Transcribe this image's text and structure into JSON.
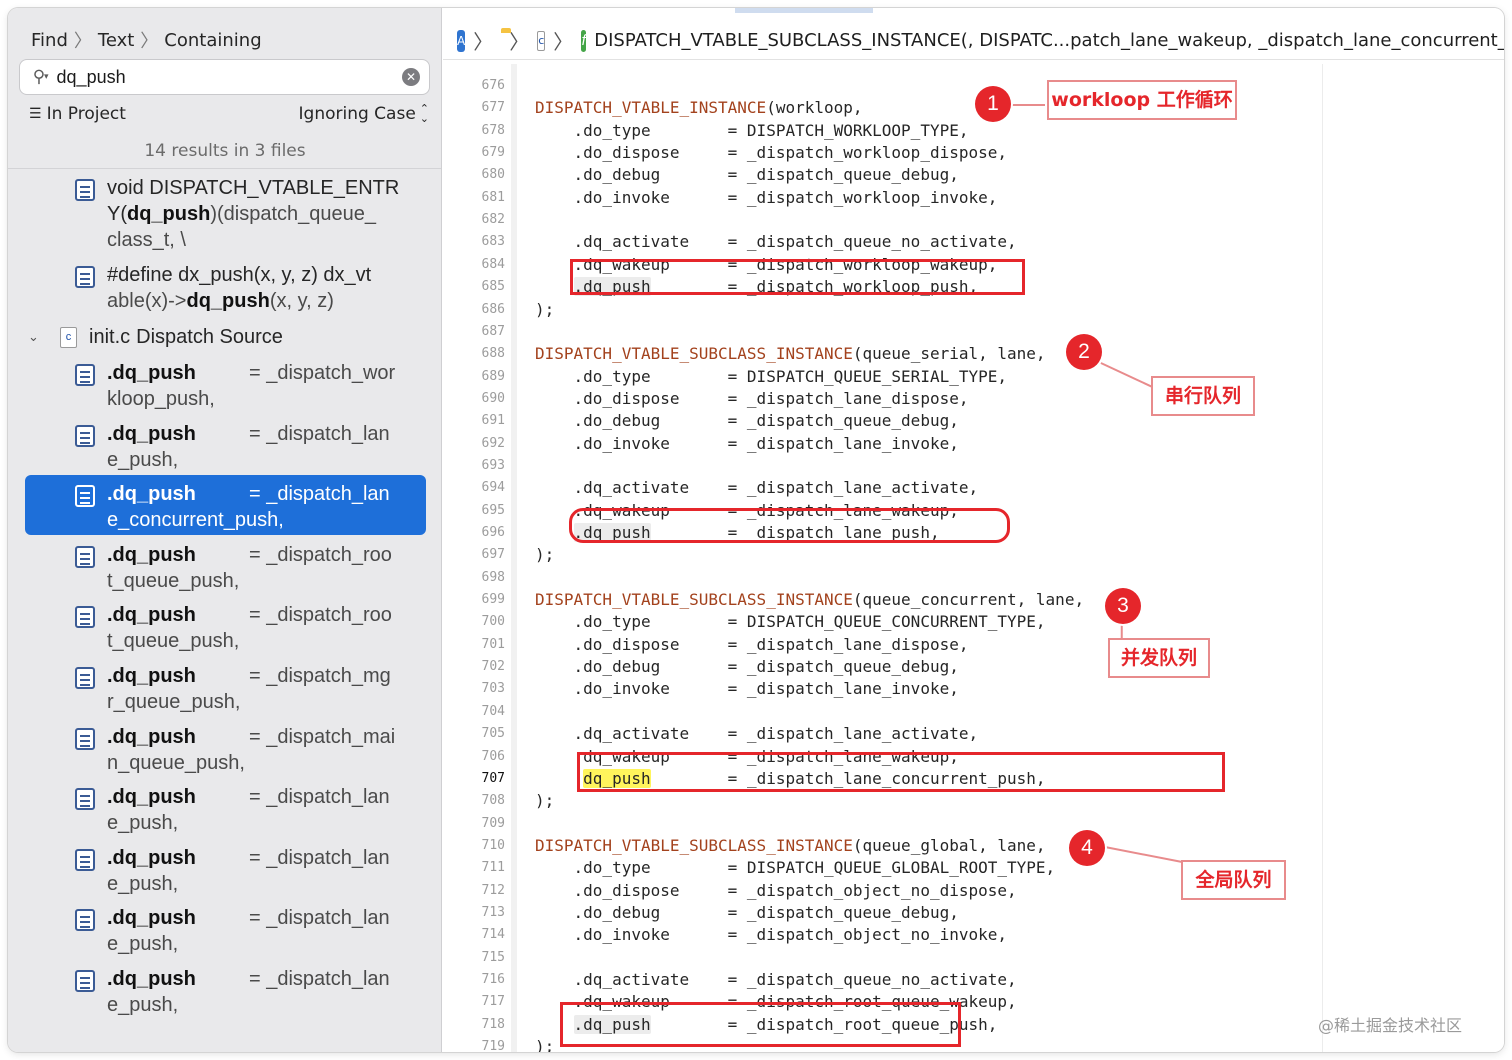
{
  "sidebar": {
    "breadcrumb": [
      "Find",
      "Text",
      "Containing"
    ],
    "search": {
      "value": "dq_push",
      "placeholder": ""
    },
    "scope": "In Project",
    "case_mode": "Ignoring Case",
    "summary": "14 results in 3 files",
    "pre_results": [
      {
        "line1_pre": "void DISPATCH_VTABLE_ENTR",
        "line2_pre": "Y(",
        "match": "dq_push",
        "line2_post": ")(dispatch_queue_",
        "line3": "class_t, \\"
      },
      {
        "line1": "#define dx_push(x, y, z) dx_vt",
        "line2_pre": "able(x)->",
        "match": "dq_push",
        "line2_post": "(x, y, z)"
      }
    ],
    "file_group": {
      "name": "init.c",
      "kind": "Dispatch Source"
    },
    "results": [
      {
        "match": ".dq_push",
        "rest1": "= _dispatch_wor",
        "rest2": "kloop_push,"
      },
      {
        "match": ".dq_push",
        "rest1": "= _dispatch_lan",
        "rest2": "e_push,"
      },
      {
        "match": ".dq_push",
        "rest1": "= _dispatch_lan",
        "rest2": "e_concurrent_push,",
        "selected": true
      },
      {
        "match": ".dq_push",
        "rest1": "= _dispatch_roo",
        "rest2": "t_queue_push,"
      },
      {
        "match": ".dq_push",
        "rest1": "= _dispatch_roo",
        "rest2": "t_queue_push,"
      },
      {
        "match": ".dq_push",
        "rest1": "= _dispatch_mg",
        "rest2": "r_queue_push,"
      },
      {
        "match": ".dq_push",
        "rest1": "= _dispatch_mai",
        "rest2": "n_queue_push,"
      },
      {
        "match": ".dq_push",
        "rest1": "= _dispatch_lan",
        "rest2": "e_push,"
      },
      {
        "match": ".dq_push",
        "rest1": "= _dispatch_lan",
        "rest2": "e_push,"
      },
      {
        "match": ".dq_push",
        "rest1": "= _dispatch_lan",
        "rest2": "e_push,"
      },
      {
        "match": ".dq_push",
        "rest1": "= _dispatch_lan",
        "rest2": "e_push,"
      }
    ]
  },
  "editor": {
    "jumpbar": {
      "file_letter": "c",
      "func_letter": "f",
      "symbol": "DISPATCH_VTABLE_SUBCLASS_INSTANCE(, DISPATC...patch_lane_wakeup, _dispatch_lane_concurrent_p"
    },
    "current_line": 707,
    "lines": [
      {
        "n": 676,
        "kw": "",
        "text": ""
      },
      {
        "n": 677,
        "kw": "DISPATCH_VTABLE_INSTANCE",
        "text": "(workloop,"
      },
      {
        "n": 678,
        "kw": "",
        "text": "    .do_type        = DISPATCH_WORKLOOP_TYPE,"
      },
      {
        "n": 679,
        "kw": "",
        "text": "    .do_dispose     = _dispatch_workloop_dispose,"
      },
      {
        "n": 680,
        "kw": "",
        "text": "    .do_debug       = _dispatch_queue_debug,"
      },
      {
        "n": 681,
        "kw": "",
        "text": "    .do_invoke      = _dispatch_workloop_invoke,"
      },
      {
        "n": 682,
        "kw": "",
        "text": ""
      },
      {
        "n": 683,
        "kw": "",
        "text": "    .dq_activate    = _dispatch_queue_no_activate,"
      },
      {
        "n": 684,
        "kw": "",
        "text": "    .dq_wakeup      = _dispatch_workloop_wakeup,"
      },
      {
        "n": 685,
        "kw": "",
        "hl": ".dq_push",
        "pre": "    ",
        "text": "        = _dispatch_workloop_push,"
      },
      {
        "n": 686,
        "kw": "",
        "text": ");"
      },
      {
        "n": 687,
        "kw": "",
        "text": ""
      },
      {
        "n": 688,
        "kw": "DISPATCH_VTABLE_SUBCLASS_INSTANCE",
        "text": "(queue_serial, lane,"
      },
      {
        "n": 689,
        "kw": "",
        "text": "    .do_type        = DISPATCH_QUEUE_SERIAL_TYPE,"
      },
      {
        "n": 690,
        "kw": "",
        "text": "    .do_dispose     = _dispatch_lane_dispose,"
      },
      {
        "n": 691,
        "kw": "",
        "text": "    .do_debug       = _dispatch_queue_debug,"
      },
      {
        "n": 692,
        "kw": "",
        "text": "    .do_invoke      = _dispatch_lane_invoke,"
      },
      {
        "n": 693,
        "kw": "",
        "text": ""
      },
      {
        "n": 694,
        "kw": "",
        "text": "    .dq_activate    = _dispatch_lane_activate,"
      },
      {
        "n": 695,
        "kw": "",
        "text": "    .dq_wakeup      = _dispatch_lane_wakeup,"
      },
      {
        "n": 696,
        "kw": "",
        "hl": ".dq_push",
        "pre": "    ",
        "text": "        = _dispatch_lane_push,"
      },
      {
        "n": 697,
        "kw": "",
        "text": ");"
      },
      {
        "n": 698,
        "kw": "",
        "text": ""
      },
      {
        "n": 699,
        "kw": "DISPATCH_VTABLE_SUBCLASS_INSTANCE",
        "text": "(queue_concurrent, lane,"
      },
      {
        "n": 700,
        "kw": "",
        "text": "    .do_type        = DISPATCH_QUEUE_CONCURRENT_TYPE,"
      },
      {
        "n": 701,
        "kw": "",
        "text": "    .do_dispose     = _dispatch_lane_dispose,"
      },
      {
        "n": 702,
        "kw": "",
        "text": "    .do_debug       = _dispatch_queue_debug,"
      },
      {
        "n": 703,
        "kw": "",
        "text": "    .do_invoke      = _dispatch_lane_invoke,"
      },
      {
        "n": 704,
        "kw": "",
        "text": ""
      },
      {
        "n": 705,
        "kw": "",
        "text": "    .dq_activate    = _dispatch_lane_activate,"
      },
      {
        "n": 706,
        "kw": "",
        "text": "    .dq_wakeup      = _dispatch_lane_wakeup,"
      },
      {
        "n": 707,
        "kw": "",
        "hly": "dq_push",
        "pre": "     ",
        "text": "        = _dispatch_lane_concurrent_push,"
      },
      {
        "n": 708,
        "kw": "",
        "text": ");"
      },
      {
        "n": 709,
        "kw": "",
        "text": ""
      },
      {
        "n": 710,
        "kw": "DISPATCH_VTABLE_SUBCLASS_INSTANCE",
        "text": "(queue_global, lane,"
      },
      {
        "n": 711,
        "kw": "",
        "text": "    .do_type        = DISPATCH_QUEUE_GLOBAL_ROOT_TYPE,"
      },
      {
        "n": 712,
        "kw": "",
        "text": "    .do_dispose     = _dispatch_object_no_dispose,"
      },
      {
        "n": 713,
        "kw": "",
        "text": "    .do_debug       = _dispatch_queue_debug,"
      },
      {
        "n": 714,
        "kw": "",
        "text": "    .do_invoke      = _dispatch_object_no_invoke,"
      },
      {
        "n": 715,
        "kw": "",
        "text": ""
      },
      {
        "n": 716,
        "kw": "",
        "text": "    .dq_activate    = _dispatch_queue_no_activate,"
      },
      {
        "n": 717,
        "kw": "",
        "text": "    .dq_wakeup      = _dispatch_root_queue_wakeup,"
      },
      {
        "n": 718,
        "kw": "",
        "hl": ".dq_push",
        "pre": "    ",
        "text": "        = _dispatch_root_queue_push,"
      },
      {
        "n": 719,
        "kw": "",
        "text": ");"
      }
    ]
  },
  "annotations": [
    {
      "badge": "1",
      "label": "workloop 工作循环"
    },
    {
      "badge": "2",
      "label": "串行队列"
    },
    {
      "badge": "3",
      "label": "并发队列"
    },
    {
      "badge": "4",
      "label": "全局队列"
    }
  ],
  "watermark": "@稀土掘金技术社区",
  "colors": {
    "selection": "#1e6fd9",
    "annotation_red": "#e5262b",
    "keyword": "#a3421d",
    "match_highlight": "#fff55c"
  }
}
